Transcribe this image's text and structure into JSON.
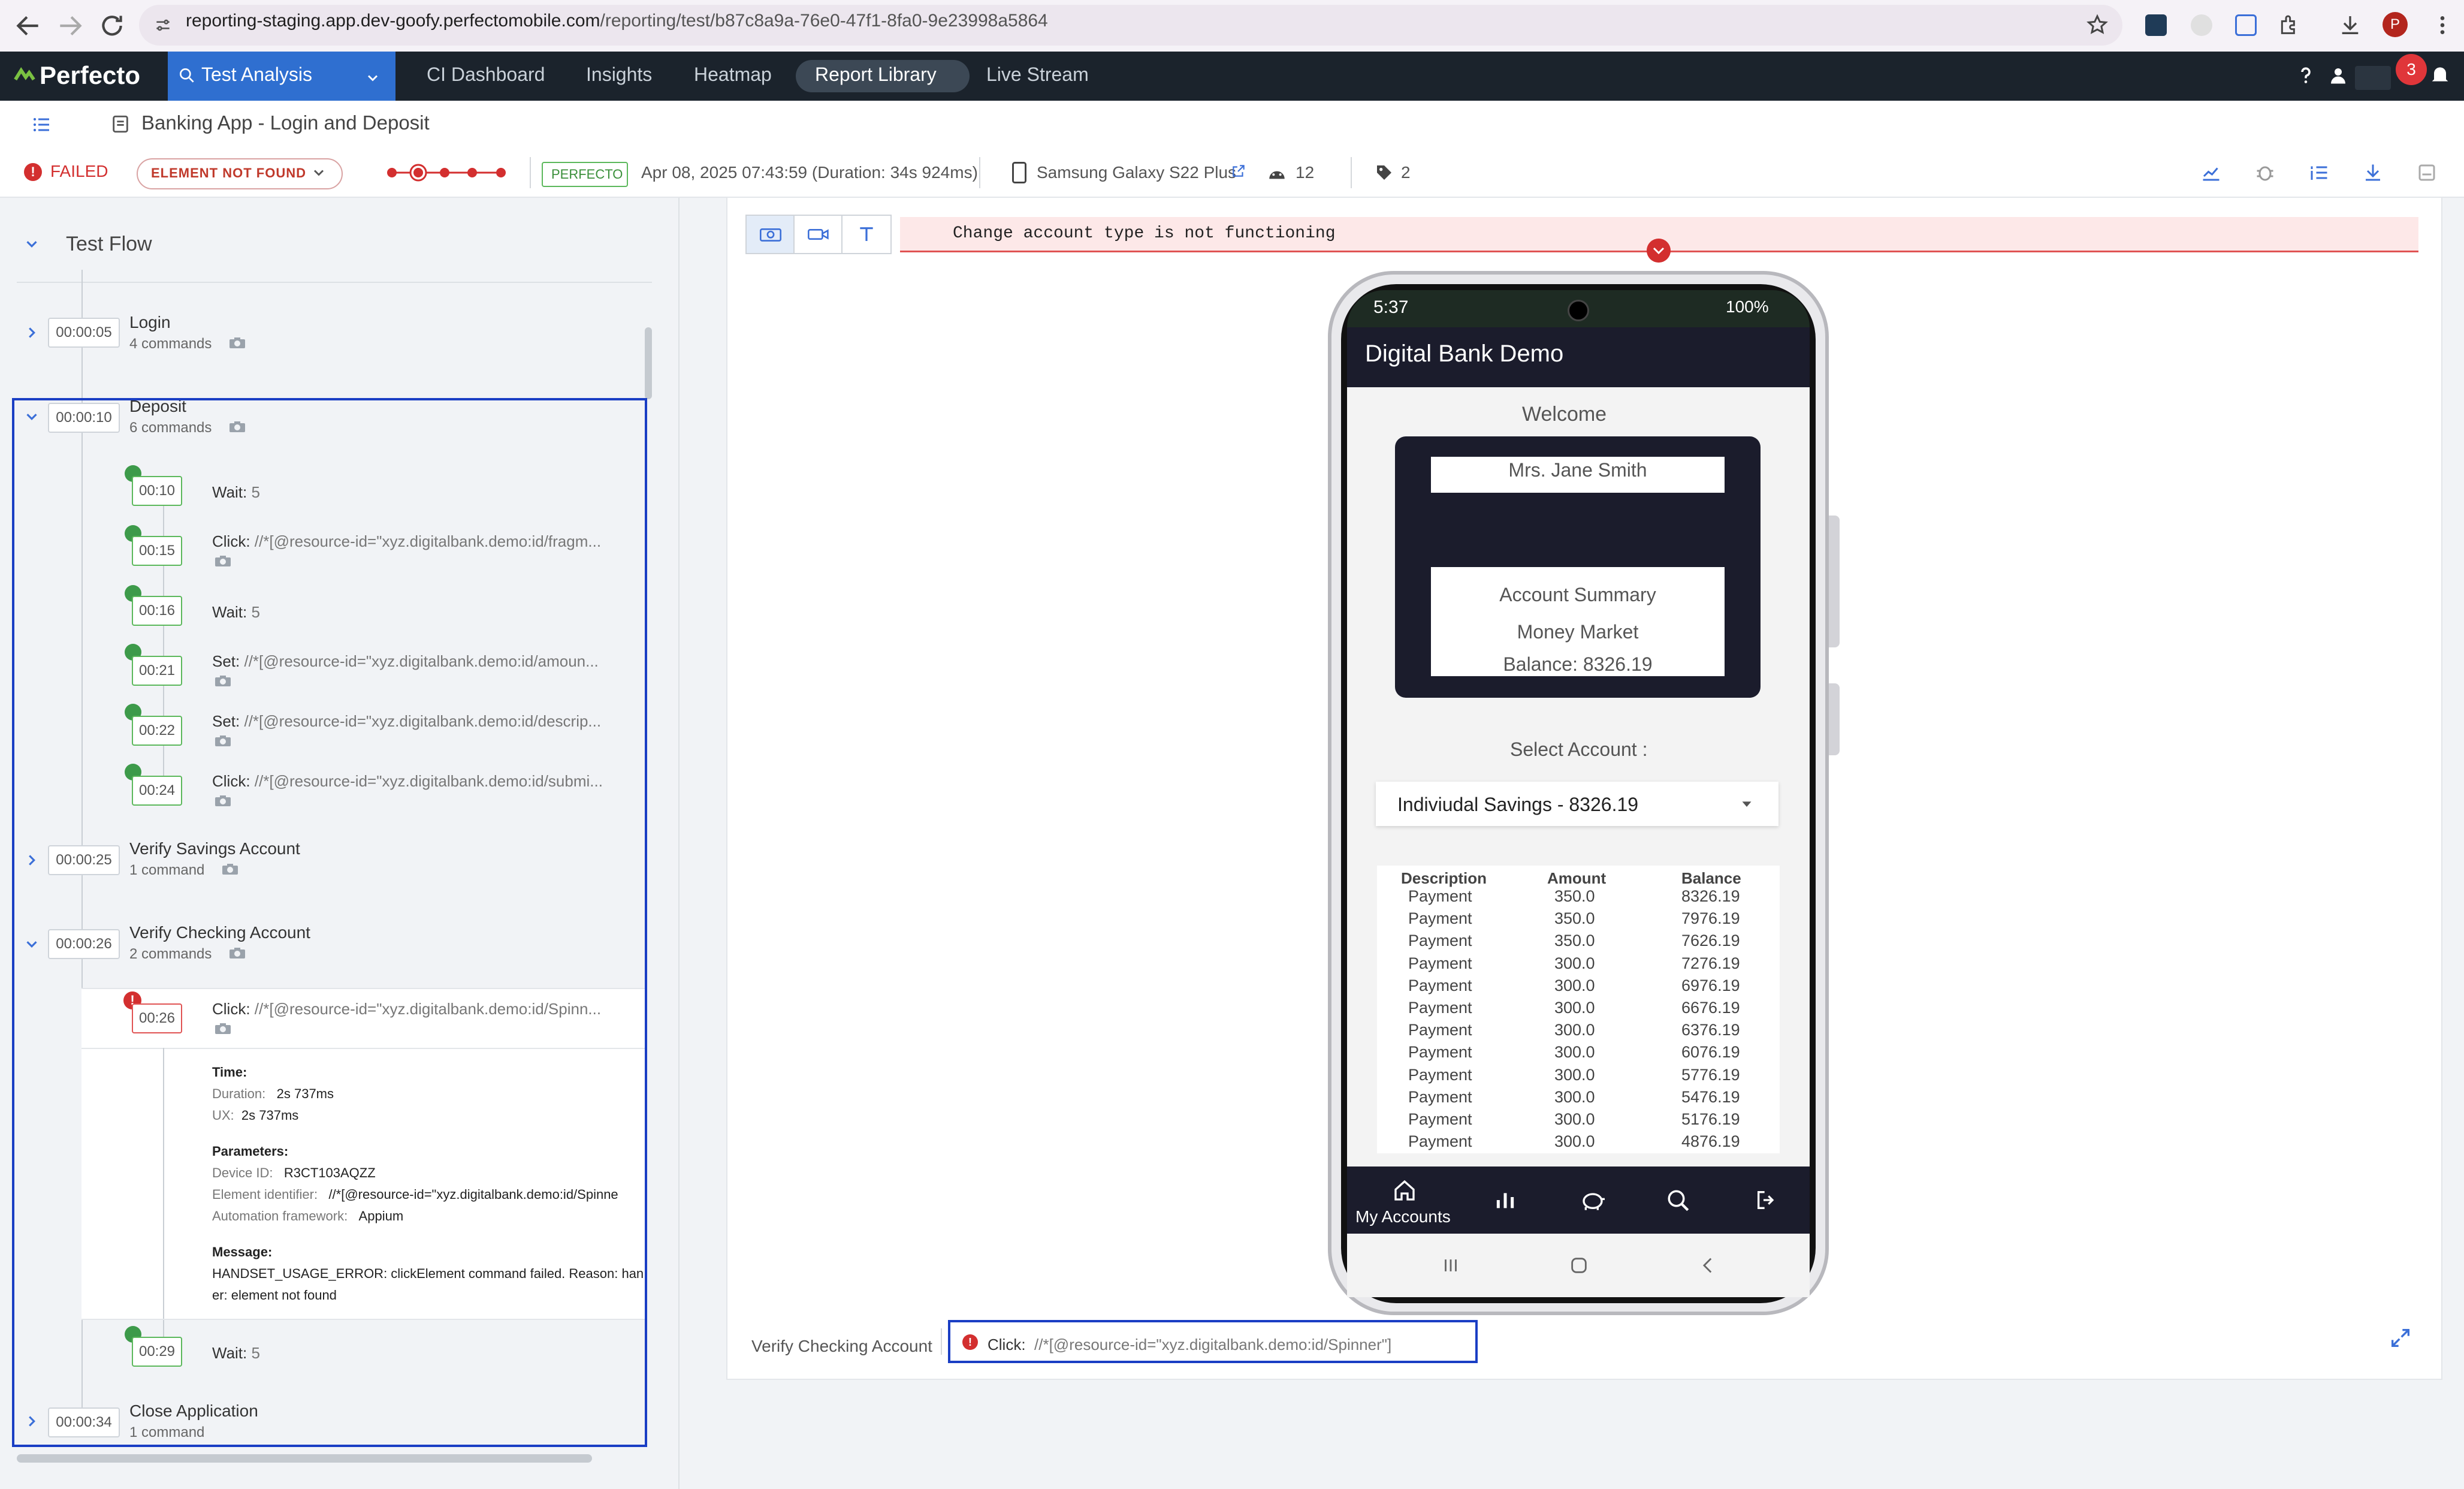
{
  "browser": {
    "url_host": "reporting-staging.app.dev-goofy.perfectomobile.com",
    "url_path": "/reporting/test/b87c8a9a-76e0-47f1-8fa0-9e23998a5864",
    "profile_initial": "P"
  },
  "header": {
    "logo": "Perfecto",
    "active_tab": "Test Analysis",
    "nav": [
      "CI Dashboard",
      "Insights",
      "Heatmap",
      "Report Library",
      "Live Stream"
    ],
    "notification_count": "3"
  },
  "breadcrumb": {
    "title": "Banking App - Login and Deposit"
  },
  "status": {
    "result": "FAILED",
    "failure_reason": "ELEMENT NOT FOUND",
    "source": "PERFECTO",
    "run_info": "Apr 08, 2025 07:43:59 (Duration: 34s 924ms)",
    "device": "Samsung Galaxy S22 Plus",
    "android_count": "12",
    "tag_count": "2"
  },
  "test_flow": {
    "title": "Test Flow",
    "groups": [
      {
        "time": "00:00:05",
        "name": "Login",
        "count": "4 commands"
      },
      {
        "time": "00:00:10",
        "name": "Deposit",
        "count": "6 commands"
      },
      {
        "time": "00:00:25",
        "name": "Verify Savings Account",
        "count": "1 command"
      },
      {
        "time": "00:00:26",
        "name": "Verify Checking Account",
        "count": "2 commands"
      },
      {
        "time": "00:00:34",
        "name": "Close Application",
        "count": "1 command"
      }
    ],
    "deposit_steps": [
      {
        "time": "00:10",
        "action": "Wait:",
        "arg": "5"
      },
      {
        "time": "00:15",
        "action": "Click:",
        "arg": "//*[@resource-id=\"xyz.digitalbank.demo:id/fragm..."
      },
      {
        "time": "00:16",
        "action": "Wait:",
        "arg": "5"
      },
      {
        "time": "00:21",
        "action": "Set:",
        "arg": "//*[@resource-id=\"xyz.digitalbank.demo:id/amoun..."
      },
      {
        "time": "00:22",
        "action": "Set:",
        "arg": "//*[@resource-id=\"xyz.digitalbank.demo:id/descrip..."
      },
      {
        "time": "00:24",
        "action": "Click:",
        "arg": "//*[@resource-id=\"xyz.digitalbank.demo:id/submi..."
      }
    ],
    "checking_steps": [
      {
        "time": "00:26",
        "action": "Click:",
        "arg": "//*[@resource-id=\"xyz.digitalbank.demo:id/Spinn..."
      },
      {
        "time": "00:29",
        "action": "Wait:",
        "arg": "5"
      }
    ],
    "details": {
      "time_header": "Time:",
      "duration_key": "Duration:",
      "duration": "2s 737ms",
      "ux_key": "UX:",
      "ux": "2s 737ms",
      "params_header": "Parameters:",
      "device_id_key": "Device ID:",
      "device_id": "R3CT103AQZZ",
      "element_key": "Element identifier:",
      "element": "//*[@resource-id=\"xyz.digitalbank.demo:id/Spinne",
      "framework_key": "Automation framework:",
      "framework": "Appium",
      "message_header": "Message:",
      "message_line1": "HANDSET_USAGE_ERROR: clickElement command failed. Reason: hand",
      "message_line2": "er: element not found"
    }
  },
  "viewer": {
    "error_banner": "Change account type is not functioning",
    "step_caption": "Verify Checking Account",
    "step_action": "Click:",
    "step_arg": "//*[@resource-id=\"xyz.digitalbank.demo:id/Spinner\"]"
  },
  "phone": {
    "time": "5:37",
    "battery": "100%",
    "app_title": "Digital Bank Demo",
    "welcome": "Welcome",
    "customer_name": "Mrs. Jane Smith",
    "summary_title": "Account Summary",
    "summary_type": "Money Market",
    "summary_balance": "Balance: 8326.19",
    "select_label": "Select Account :",
    "selected_account": "Indiviudal Savings - 8326.19",
    "table_headers": [
      "Description",
      "Amount",
      "Balance"
    ],
    "transactions": [
      [
        "Payment",
        "350.0",
        "8326.19"
      ],
      [
        "Payment",
        "350.0",
        "7976.19"
      ],
      [
        "Payment",
        "350.0",
        "7626.19"
      ],
      [
        "Payment",
        "300.0",
        "7276.19"
      ],
      [
        "Payment",
        "300.0",
        "6976.19"
      ],
      [
        "Payment",
        "300.0",
        "6676.19"
      ],
      [
        "Payment",
        "300.0",
        "6376.19"
      ],
      [
        "Payment",
        "300.0",
        "6076.19"
      ],
      [
        "Payment",
        "300.0",
        "5776.19"
      ],
      [
        "Payment",
        "300.0",
        "5476.19"
      ],
      [
        "Payment",
        "300.0",
        "5176.19"
      ],
      [
        "Payment",
        "300.0",
        "4876.19"
      ]
    ],
    "bottom_nav_label": "My Accounts"
  }
}
